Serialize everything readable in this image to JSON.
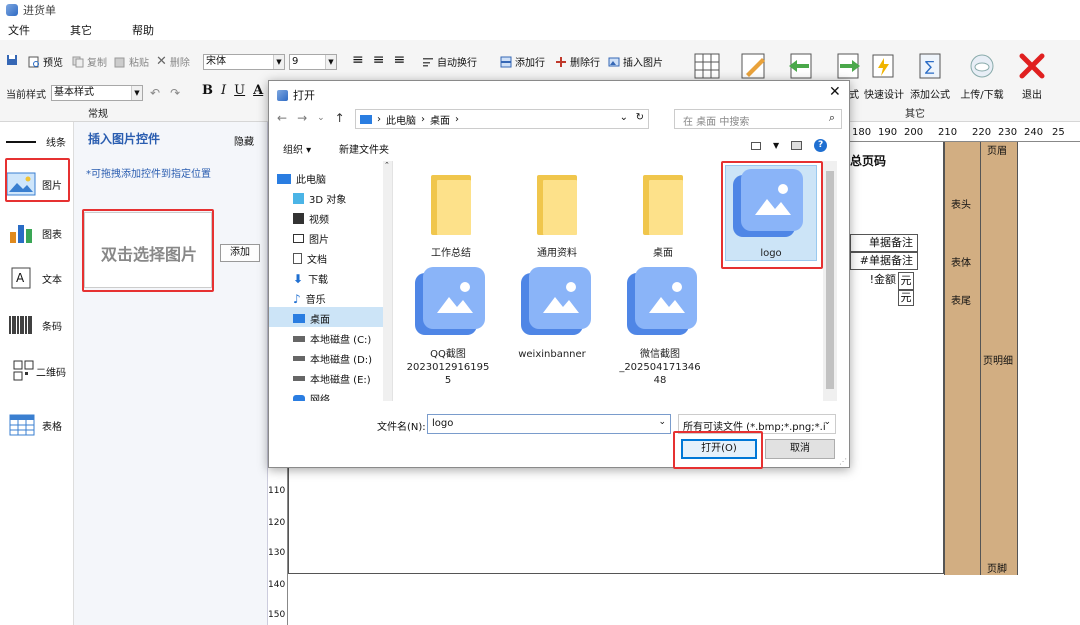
{
  "window": {
    "title": "进货单"
  },
  "menu": [
    "文件",
    "其它",
    "帮助"
  ],
  "ribbon": {
    "tools": {
      "preview": "预览",
      "copy": "复制",
      "paste": "粘贴",
      "delete": "删除",
      "font": "宋体",
      "size": "9",
      "wrap": "自动换行",
      "add_row": "添加行",
      "del_row": "删除行",
      "insert_image": "插入图片"
    },
    "style_label": "当前样式",
    "style_value": "基本样式",
    "group_normal": "常规",
    "format": {
      "bold": "B",
      "italic": "I",
      "underline": "U",
      "color": "A"
    },
    "big": {
      "fmt_partial": "式",
      "quick_design": "快速设计",
      "add_formula": "添加公式",
      "upload": "上传/下载",
      "exit": "退出"
    },
    "group_other": "其它"
  },
  "left": {
    "items": [
      {
        "label": "线条",
        "icon": "line-icon"
      },
      {
        "label": "图片",
        "icon": "picture-icon"
      },
      {
        "label": "图表",
        "icon": "bar-chart-icon"
      },
      {
        "label": "文本",
        "icon": "text-icon"
      },
      {
        "label": "条码",
        "icon": "barcode-icon"
      },
      {
        "label": "二维码",
        "icon": "qrcode-icon"
      },
      {
        "label": "表格",
        "icon": "table-icon"
      }
    ]
  },
  "panel": {
    "title": "插入图片控件",
    "hide": "隐藏",
    "hint": "*可拖拽添加控件到指定位置",
    "dropzone": "双击选择图片",
    "add": "添加"
  },
  "ruler": {
    "top": [
      "180",
      "190",
      "200",
      "210",
      "220",
      "230",
      "240",
      "25"
    ],
    "left": [
      "110",
      "120",
      "130",
      "140",
      "150"
    ]
  },
  "sheet": {
    "bands": [
      "页眉",
      "表头",
      "表体",
      "表尾",
      "页明细",
      "页脚"
    ],
    "cells": {
      "page_code": "总页码",
      "remark1": "单据备注",
      "remark2": "#单据备注",
      "amount": "!金额",
      "unit1": "元",
      "unit2": "元"
    }
  },
  "dialog": {
    "title": "打开",
    "path": [
      "此电脑",
      "桌面"
    ],
    "search_placeholder": "在 桌面 中搜索",
    "organize": "组织 ▾",
    "new_folder": "新建文件夹",
    "nav": [
      {
        "label": "此电脑",
        "icon": "pc-icon"
      },
      {
        "label": "3D 对象",
        "icon": "3d-icon"
      },
      {
        "label": "视频",
        "icon": "video-icon"
      },
      {
        "label": "图片",
        "icon": "pictures-icon"
      },
      {
        "label": "文档",
        "icon": "document-icon"
      },
      {
        "label": "下载",
        "icon": "download-icon"
      },
      {
        "label": "音乐",
        "icon": "music-icon"
      },
      {
        "label": "桌面",
        "icon": "desktop-icon"
      },
      {
        "label": "本地磁盘 (C:)",
        "icon": "drive-icon"
      },
      {
        "label": "本地磁盘 (D:)",
        "icon": "drive-icon"
      },
      {
        "label": "本地磁盘 (E:)",
        "icon": "drive-icon"
      },
      {
        "label": "网络",
        "icon": "network-icon"
      }
    ],
    "files": [
      {
        "name": "工作总结",
        "type": "folder"
      },
      {
        "name": "通用资料",
        "type": "folder"
      },
      {
        "name": "桌面",
        "type": "folder"
      },
      {
        "name": "logo",
        "type": "image"
      },
      {
        "name": "QQ截图\n2023012916195\n5",
        "type": "image"
      },
      {
        "name": "weixinbanner",
        "type": "image"
      },
      {
        "name": "微信截图\n_202504171346\n48",
        "type": "image"
      }
    ],
    "filename_label": "文件名(N):",
    "filename_value": "logo",
    "filter": "所有可读文件 (*.bmp;*.png;*.i",
    "open": "打开(O)",
    "cancel": "取消"
  }
}
